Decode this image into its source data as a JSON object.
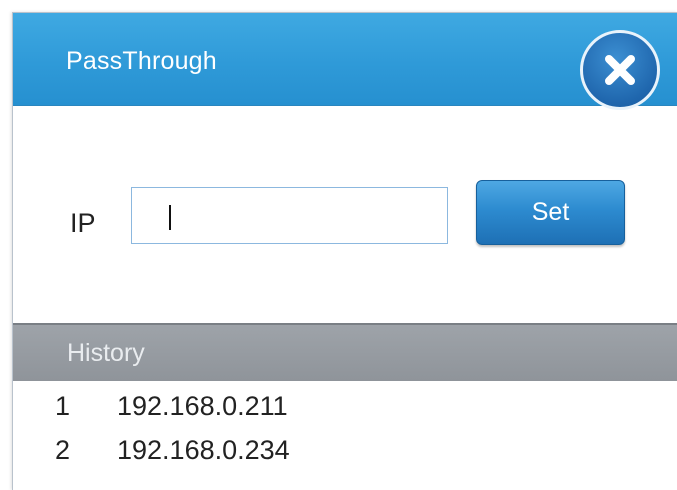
{
  "dialog": {
    "title": "PassThrough",
    "close_icon": "close-icon"
  },
  "form": {
    "ip_label": "IP",
    "ip_value": "",
    "set_label": "Set"
  },
  "history": {
    "title": "History",
    "items": [
      {
        "index": "1",
        "ip": "192.168.0.211"
      },
      {
        "index": "2",
        "ip": "192.168.0.234"
      }
    ]
  },
  "colors": {
    "titlebar": "#2f9ad8",
    "close_button": "#1f66ad",
    "set_button": "#2d8bd0",
    "history_header": "#969ba1"
  }
}
